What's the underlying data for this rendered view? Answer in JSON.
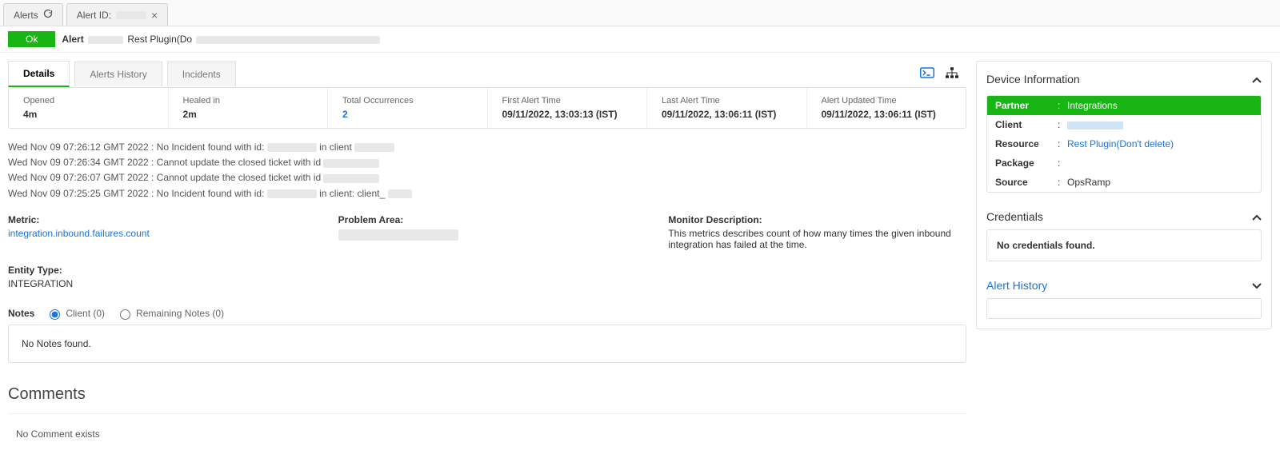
{
  "top_tabs": {
    "alerts": "Alerts",
    "alert_id_label": "Alert ID:"
  },
  "status": {
    "badge": "Ok",
    "prefix": "Alert",
    "tail": "Rest Plugin(Do"
  },
  "sub_tabs": {
    "details": "Details",
    "history": "Alerts History",
    "incidents": "Incidents"
  },
  "summary": {
    "opened_label": "Opened",
    "opened_value": "4m",
    "healed_label": "Healed in",
    "healed_value": "2m",
    "occ_label": "Total Occurrences",
    "occ_value": "2",
    "first_label": "First Alert Time",
    "first_value": "09/11/2022, 13:03:13 (IST)",
    "last_label": "Last Alert Time",
    "last_value": "09/11/2022, 13:06:11 (IST)",
    "upd_label": "Alert Updated Time",
    "upd_value": "09/11/2022, 13:06:11 (IST)"
  },
  "log": {
    "l1a": "Wed Nov 09 07:26:12 GMT 2022 : No Incident found with id:",
    "l1b": "in client",
    "l2": "Wed Nov 09 07:26:34 GMT 2022 : Cannot update the closed ticket with id",
    "l3": "Wed Nov 09 07:26:07 GMT 2022 : Cannot update the closed ticket with id",
    "l4a": "Wed Nov 09 07:25:25 GMT 2022 : No Incident found with id:",
    "l4b": "in client: client_"
  },
  "details": {
    "metric_label": "Metric:",
    "metric_value": "integration.inbound.failures.count",
    "problem_label": "Problem Area:",
    "monitor_label": "Monitor Description:",
    "monitor_value": "This metrics describes count of how many times the given inbound integration has failed at the time.",
    "entity_label": "Entity Type:",
    "entity_value": "INTEGRATION"
  },
  "notes": {
    "section": "Notes",
    "opt_client": "Client (0)",
    "opt_remaining": "Remaining Notes (0)",
    "empty": "No Notes found."
  },
  "comments": {
    "heading": "Comments",
    "empty": "No Comment exists"
  },
  "device": {
    "header": "Device Information",
    "partner_k": "Partner",
    "partner_v": "Integrations",
    "client_k": "Client",
    "resource_k": "Resource",
    "resource_v": "Rest Plugin(Don't delete)",
    "package_k": "Package",
    "source_k": "Source",
    "source_v": "OpsRamp"
  },
  "credentials": {
    "header": "Credentials",
    "empty": "No credentials found."
  },
  "alert_history": {
    "header": "Alert History"
  }
}
